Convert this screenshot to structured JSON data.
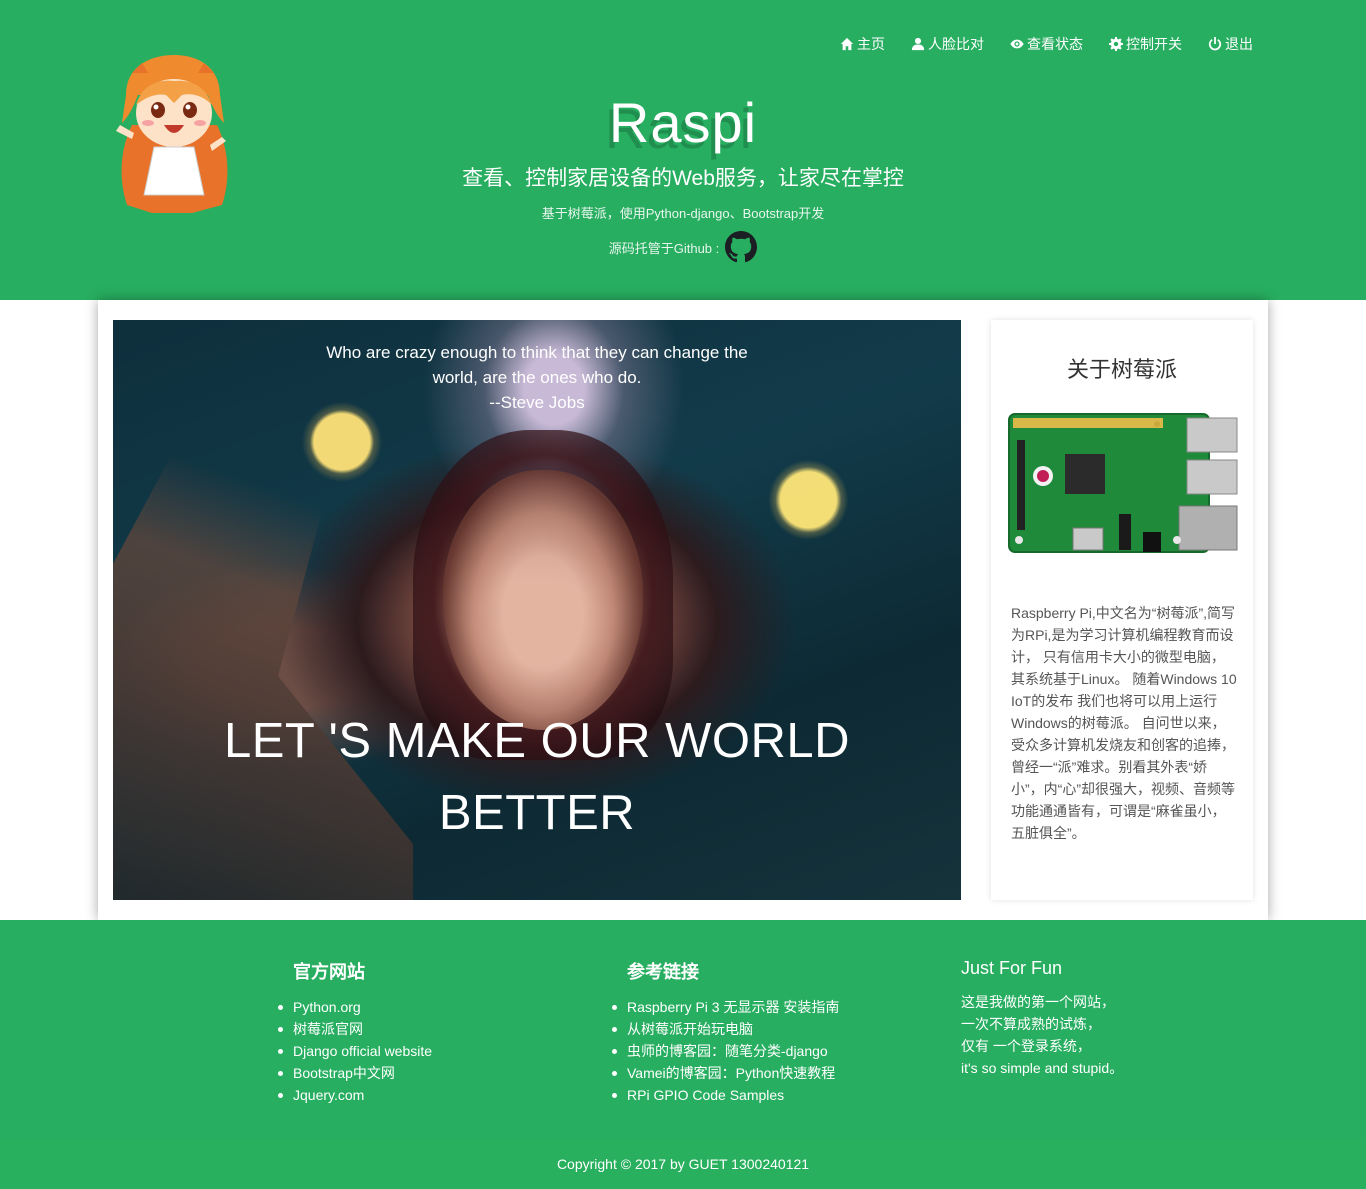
{
  "nav": {
    "items": [
      {
        "label": "主页",
        "icon": "home-icon"
      },
      {
        "label": "人脸比对",
        "icon": "user-icon"
      },
      {
        "label": "查看状态",
        "icon": "eye-icon"
      },
      {
        "label": "控制开关",
        "icon": "gear-icon"
      },
      {
        "label": "退出",
        "icon": "power-icon"
      }
    ]
  },
  "header": {
    "title": "Raspi",
    "subtitle": "查看、控制家居设备的Web服务，让家尽在掌控",
    "tagline": "基于树莓派，使用Python-django、Bootstrap开发",
    "source_label": "源码托管于Github :"
  },
  "hero": {
    "quote_lines": [
      "Who are crazy enough to think that they can change the world, are the ones who do.",
      "--Steve Jobs"
    ],
    "headline_lines": [
      "LET 'S MAKE OUR WORLD",
      "BETTER"
    ]
  },
  "sidebar": {
    "title": "关于树莓派",
    "description": "Raspberry Pi,中文名为“树莓派”,简写为RPi,是为学习计算机编程教育而设计， 只有信用卡大小的微型电脑，其系统基于Linux。 随着Windows 10 IoT的发布 我们也将可以用上运行Windows的树莓派。 自问世以来，受众多计算机发烧友和创客的追捧， 曾经一“派”难求。别看其外表“娇小”，内“心”却很强大，视频、音频等功能通通皆有，可谓是“麻雀虽小，五脏俱全”。"
  },
  "footer": {
    "official": {
      "title": "官方网站",
      "links": [
        "Python.org",
        "树莓派官网",
        "Django official website",
        "Bootstrap中文网",
        "Jquery.com"
      ]
    },
    "references": {
      "title": "参考链接",
      "links": [
        "Raspberry Pi 3 无显示器 安装指南",
        "从树莓派开始玩电脑",
        "虫师的博客园：随笔分类-django",
        "Vamei的博客园：Python快速教程",
        "RPi GPIO Code Samples"
      ]
    },
    "fun": {
      "title": "Just For Fun",
      "lines": [
        "这是我做的第一个网站，",
        "一次不算成熟的试炼，",
        "仅有 一个登录系统，",
        "it's so simple and stupid。"
      ]
    },
    "copyright": "Copyright © 2017 by GUET 1300240121"
  },
  "colors": {
    "brand_green": "#27ae60",
    "text_dark": "#333333"
  }
}
